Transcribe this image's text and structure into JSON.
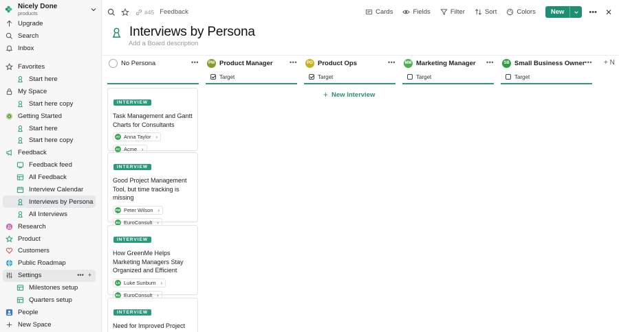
{
  "workspace": {
    "name": "Nicely Done",
    "subtitle": "products"
  },
  "sidebar": {
    "top": [
      {
        "label": "Upgrade",
        "icon": "upgrade-icon"
      },
      {
        "label": "Search",
        "icon": "search-icon"
      },
      {
        "label": "Inbox",
        "icon": "inbox-icon"
      }
    ],
    "items": [
      {
        "label": "Favorites",
        "icon": "star-icon",
        "level": 0
      },
      {
        "label": "Start here",
        "icon": "persona-icon",
        "level": 1
      },
      {
        "label": "My Space",
        "icon": "lock-icon",
        "level": 0
      },
      {
        "label": "Start here copy",
        "icon": "persona-icon",
        "level": 1
      },
      {
        "label": "Getting Started",
        "icon": "compass-icon",
        "level": 0
      },
      {
        "label": "Start here",
        "icon": "persona-icon",
        "level": 1
      },
      {
        "label": "Start here copy",
        "icon": "persona-icon",
        "level": 1
      },
      {
        "label": "Feedback",
        "icon": "megaphone-icon",
        "level": 0
      },
      {
        "label": "Feedback feed",
        "icon": "feed-icon",
        "level": 1
      },
      {
        "label": "All Feedback",
        "icon": "table-icon",
        "level": 1
      },
      {
        "label": "Interview Calendar",
        "icon": "calendar-icon",
        "level": 1
      },
      {
        "label": "Interviews by Persona",
        "icon": "persona-icon",
        "level": 1,
        "active": true
      },
      {
        "label": "All Interviews",
        "icon": "persona-icon",
        "level": 1
      },
      {
        "label": "Research",
        "icon": "flask-icon",
        "level": 0
      },
      {
        "label": "Product",
        "icon": "star-outline-icon",
        "level": 0
      },
      {
        "label": "Customers",
        "icon": "heart-icon",
        "level": 0
      },
      {
        "label": "Public Roadmap",
        "icon": "globe-icon",
        "level": 0
      },
      {
        "label": "Settings",
        "icon": "sliders-icon",
        "level": 0,
        "hover": true
      },
      {
        "label": "Milestones setup",
        "icon": "table-icon",
        "level": 1
      },
      {
        "label": "Quarters setup",
        "icon": "table-icon",
        "level": 1
      },
      {
        "label": "People",
        "icon": "people-icon",
        "level": 0
      },
      {
        "label": "New Space",
        "icon": "plus-icon",
        "level": 0
      }
    ]
  },
  "topbar": {
    "board_id": "#45",
    "breadcrumb": "Feedback",
    "cards": "Cards",
    "fields": "Fields",
    "filter": "Filter",
    "sort": "Sort",
    "colors": "Colors",
    "new": "New"
  },
  "board": {
    "title": "Interviews by Persona",
    "description_placeholder": "Add a Board description",
    "new_interview": "New Interview",
    "add_column_label": "N"
  },
  "columns": [
    {
      "name": "No Persona",
      "initials": "",
      "avatar_color": "",
      "target": null
    },
    {
      "name": "Product Manager",
      "initials": "PM",
      "avatar_color": "#8a9a2a",
      "target": {
        "label": "Target",
        "checked": true
      }
    },
    {
      "name": "Product Ops",
      "initials": "PO",
      "avatar_color": "#c9b21f",
      "target": {
        "label": "Target",
        "checked": true
      }
    },
    {
      "name": "Marketing Manager",
      "initials": "MM",
      "avatar_color": "#4caf50",
      "target": {
        "label": "Target",
        "checked": false
      }
    },
    {
      "name": "Small Business Owner",
      "initials": "SB",
      "avatar_color": "#2e9e3e",
      "target": {
        "label": "Target",
        "checked": false
      }
    }
  ],
  "cards": [
    {
      "badge": "INTERVIEW",
      "title": "Task Management and Gantt Charts for Consultants",
      "chips": [
        {
          "initials": "AT",
          "label": "Anna Taylor"
        },
        {
          "initials": "AC",
          "label": "Acme"
        }
      ]
    },
    {
      "badge": "INTERVIEW",
      "title": "Good Project Management Tool, but time tracking is missing",
      "chips": [
        {
          "initials": "PW",
          "label": "Peter Wilson"
        },
        {
          "initials": "EU",
          "label": "EuroConsult"
        }
      ]
    },
    {
      "badge": "INTERVIEW",
      "title": "How GreenMe Helps Marketing Managers Stay Organized and Efficient",
      "chips": [
        {
          "initials": "LS",
          "label": "Luke Sunburn"
        },
        {
          "initials": "EU",
          "label": "EuroConsult"
        }
      ]
    },
    {
      "badge": "INTERVIEW",
      "title": "Need for Improved Project Management Features",
      "chips": []
    }
  ],
  "colors": {
    "accent": "#1f8f73",
    "badge": "#2a9a7d",
    "column_line": "#2c9a7e"
  }
}
